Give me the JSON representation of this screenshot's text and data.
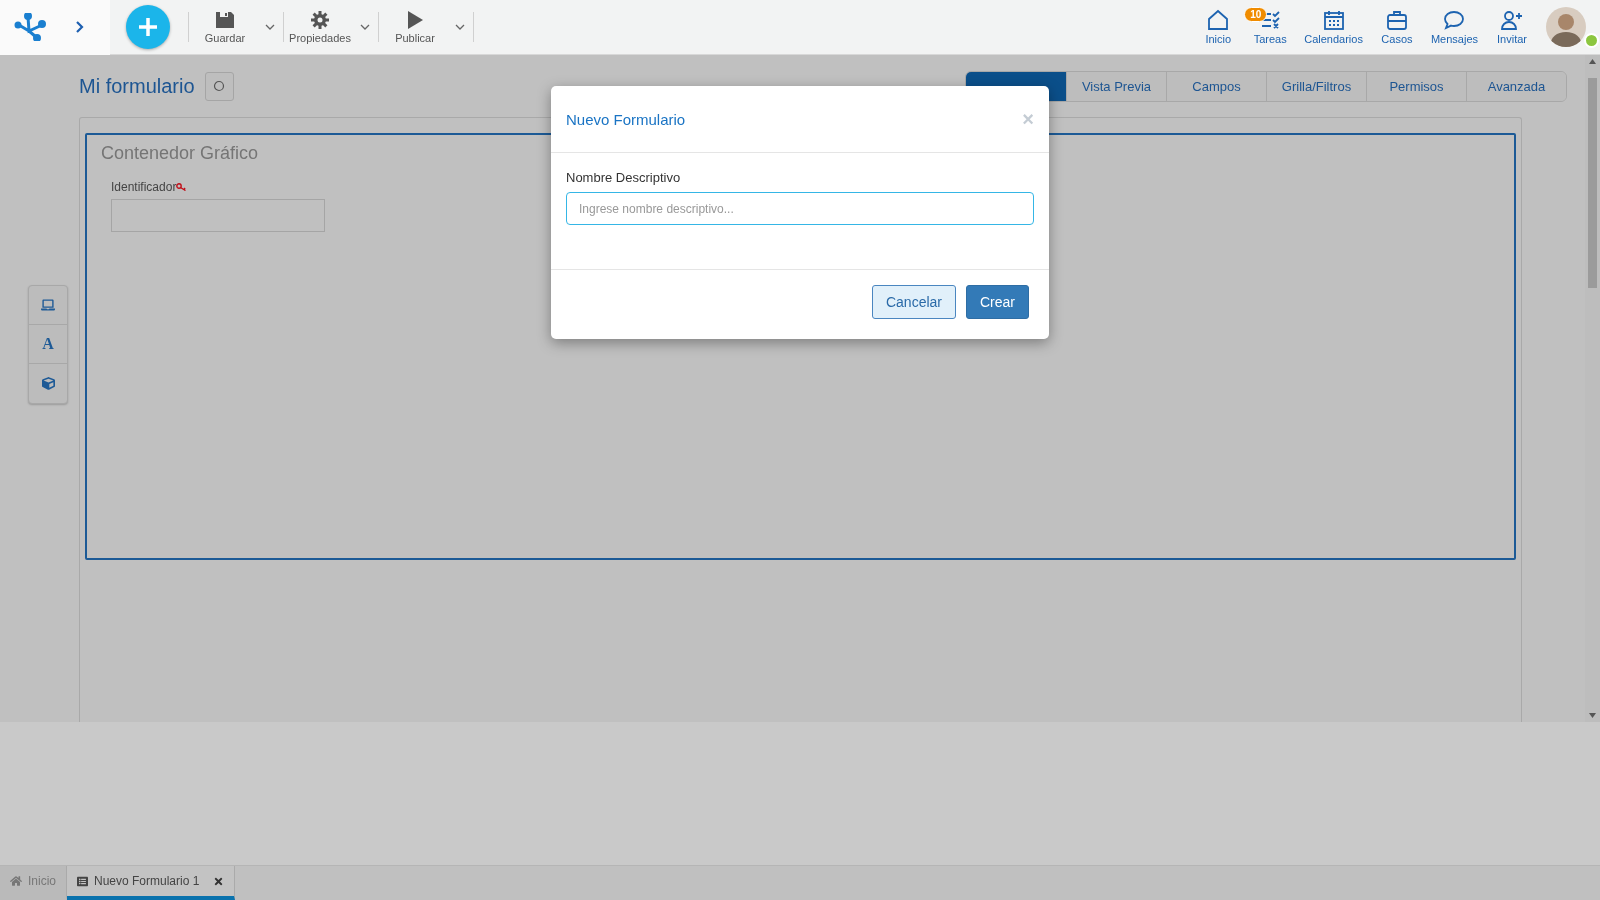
{
  "toolbar": {
    "actions": [
      {
        "kind": "save",
        "label": "Guardar"
      },
      {
        "kind": "settings",
        "label": "Propiedades"
      },
      {
        "kind": "play",
        "label": "Publicar"
      }
    ]
  },
  "nav": [
    {
      "kind": "home",
      "label": "Inicio"
    },
    {
      "kind": "tasks",
      "label": "Tareas",
      "badge": "10"
    },
    {
      "kind": "calendar",
      "label": "Calendarios"
    },
    {
      "kind": "briefcase",
      "label": "Casos"
    },
    {
      "kind": "chat",
      "label": "Mensajes"
    },
    {
      "kind": "invite",
      "label": "Invitar"
    }
  ],
  "page": {
    "title": "Mi formulario"
  },
  "tabs": [
    {
      "selected": true
    },
    {
      "label": "Vista Previa",
      "selected": false
    },
    {
      "label": "Campos",
      "selected": false
    },
    {
      "label": "Grilla/Filtros",
      "selected": false
    },
    {
      "label": "Permisos",
      "selected": false
    },
    {
      "label": "Avanzada",
      "selected": false
    }
  ],
  "side_tools": [
    {
      "kind": "laptop"
    },
    {
      "kind": "text",
      "label": "A"
    },
    {
      "kind": "cube"
    }
  ],
  "container": {
    "title": "Contenedor Gráfico",
    "field_label": "Identificador"
  },
  "dialog": {
    "title": "Nuevo Formulario",
    "close": "×",
    "field_label": "Nombre Descriptivo",
    "placeholder": "Ingrese nombre descriptivo...",
    "buttons": [
      {
        "kind": "secondary",
        "label": "Cancelar"
      },
      {
        "kind": "primary",
        "label": "Crear"
      }
    ]
  },
  "bottom_tabs": [
    {
      "kind": "home",
      "label": "Inicio",
      "selected": false
    },
    {
      "kind": "form",
      "label": "Nuevo Formulario 1",
      "selected": true,
      "closable": true
    }
  ]
}
